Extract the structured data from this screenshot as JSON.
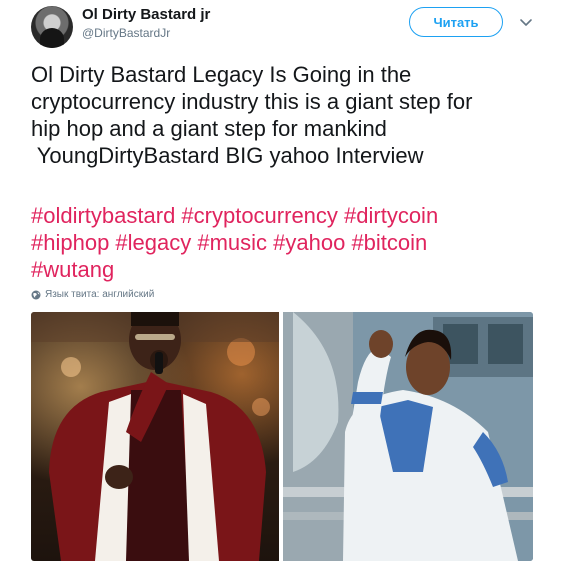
{
  "user": {
    "name": "Ol Dirty Bastard jr",
    "handle": "@DirtyBastardJr"
  },
  "follow_button": {
    "label": "Читать",
    "color": "#1da1f2"
  },
  "tweet": {
    "text_lines": [
      "Ol Dirty Bastard Legacy Is Going in the",
      "cryptocurrency industry this is a giant step for",
      "hip hop and a giant step for mankind",
      " YoungDirtyBastard BIG yahoo Interview"
    ],
    "hashtag_lines": [
      "#oldirtybastard #cryptocurrency #dirtycoin",
      "#hiphop #legacy #music #yahoo #bitcoin",
      "#wutang"
    ],
    "hashtag_color": "#e0245e",
    "language_note": "Язык твита: английский"
  },
  "icons": {
    "chevron": "chevron-down-icon",
    "globe": "globe-icon"
  }
}
